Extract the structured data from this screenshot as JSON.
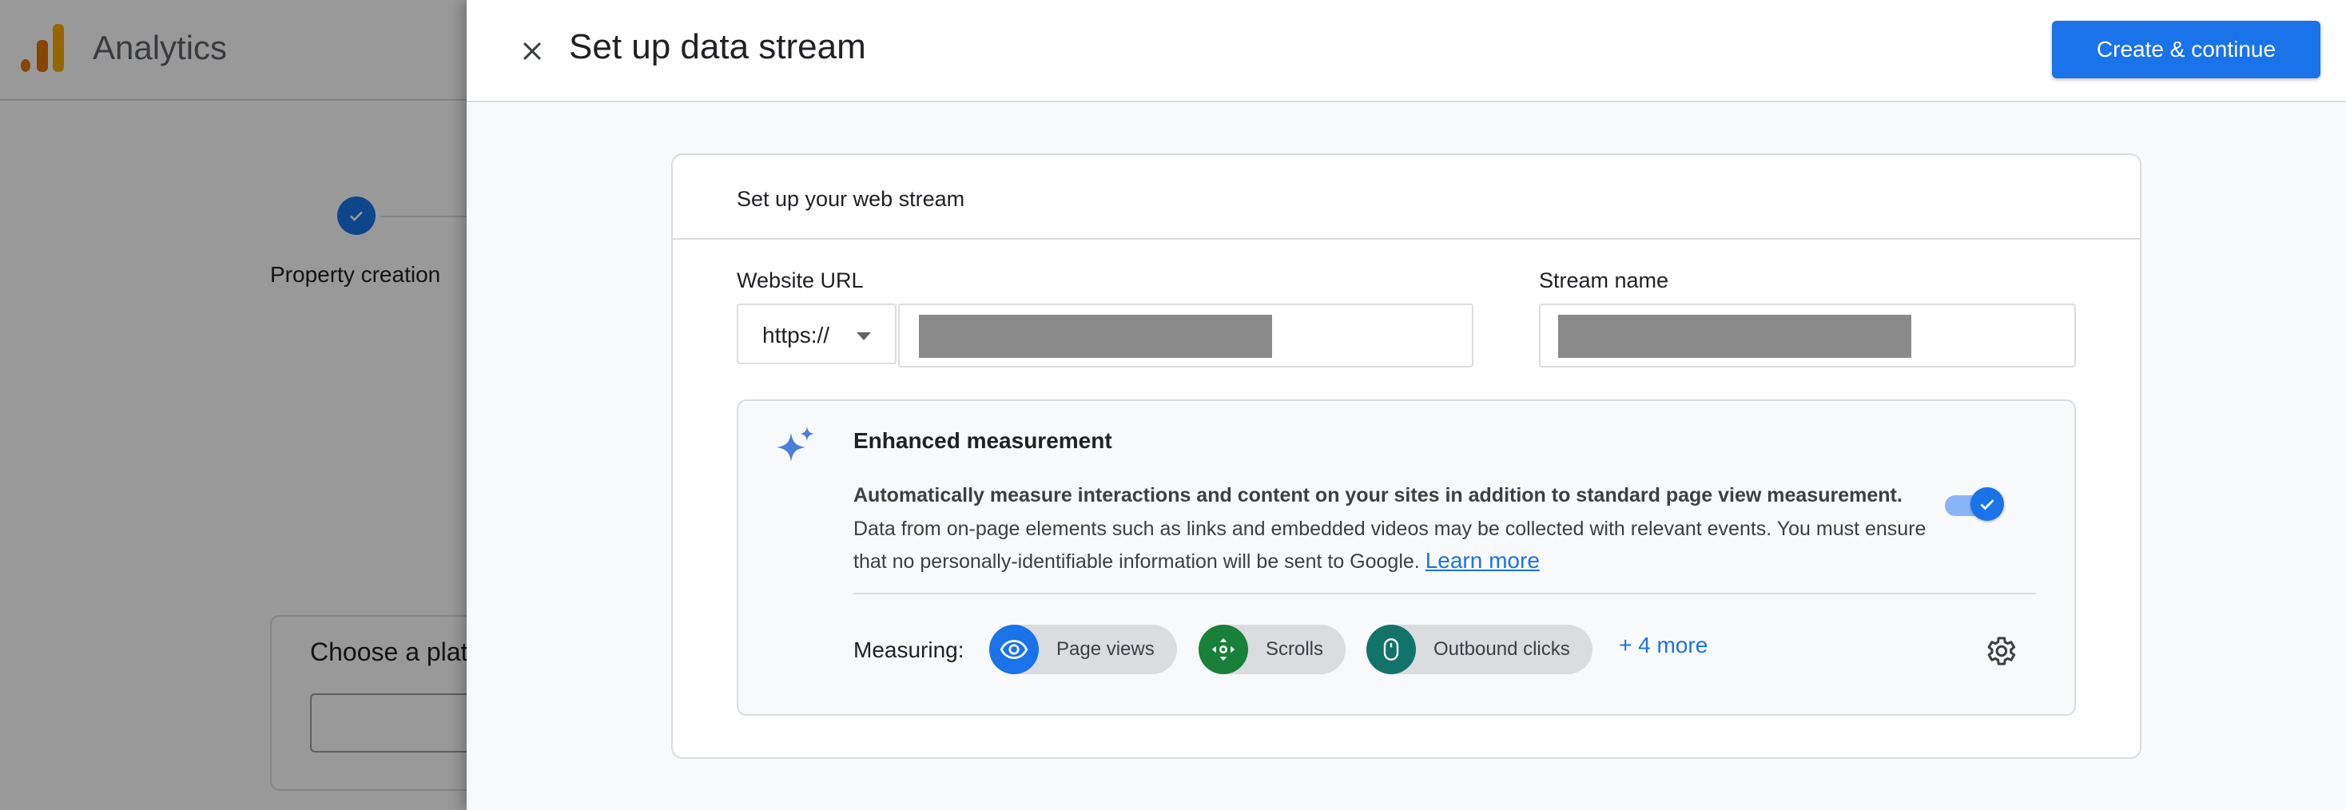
{
  "background": {
    "app_title": "Analytics",
    "step_label": "Property creation",
    "choose_platform_label": "Choose a plat"
  },
  "panel": {
    "title": "Set up data stream",
    "create_button": "Create & continue",
    "card_title": "Set up your web stream",
    "website_url_label": "Website URL",
    "protocol_value": "https://",
    "stream_name_label": "Stream name",
    "enhanced": {
      "title": "Enhanced measurement",
      "bold_text": "Automatically measure interactions and content on your sites in addition to standard page view measurement.",
      "description": "Data from on-page elements such as links and embedded videos may be collected with relevant events. You must ensure that no personally-identifiable information will be sent to Google.",
      "learn_more": "Learn more",
      "toggle_on": true,
      "measuring_label": "Measuring:",
      "chips": [
        {
          "label": "Page views",
          "icon": "eye-icon",
          "color": "#1a73e8"
        },
        {
          "label": "Scrolls",
          "icon": "scroll-arrows-icon",
          "color": "#188038"
        },
        {
          "label": "Outbound clicks",
          "icon": "mouse-icon",
          "color": "#12736b"
        }
      ],
      "more_link": "+ 4 more"
    }
  },
  "colors": {
    "accent": "#1a73e8",
    "analytics_orange": "#e37400",
    "analytics_yellow": "#f9ab00"
  }
}
